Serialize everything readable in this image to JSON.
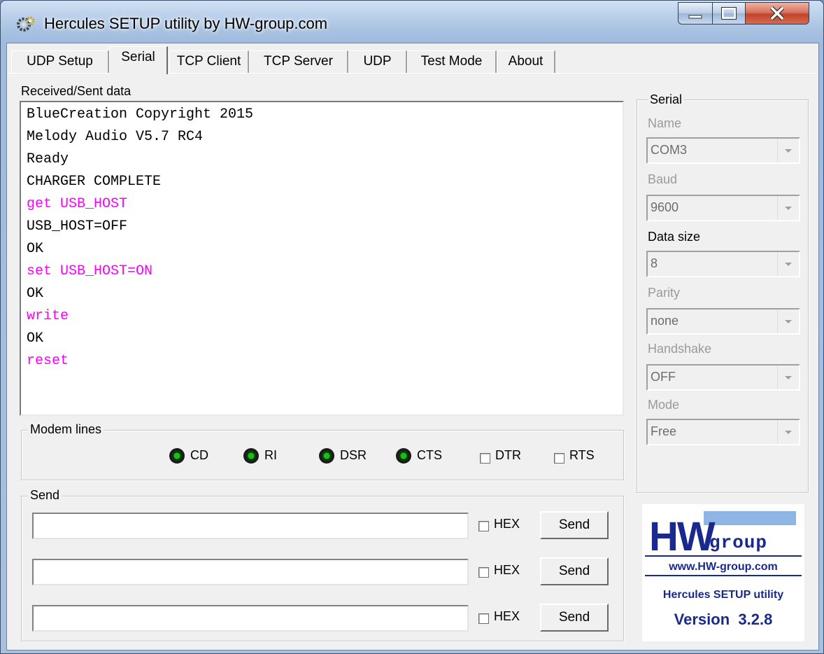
{
  "window": {
    "title": "Hercules SETUP utility by HW-group.com"
  },
  "tabs": [
    {
      "label": "UDP Setup"
    },
    {
      "label": "Serial",
      "active": true
    },
    {
      "label": "TCP Client"
    },
    {
      "label": "TCP Server"
    },
    {
      "label": "UDP"
    },
    {
      "label": "Test Mode"
    },
    {
      "label": "About"
    }
  ],
  "received": {
    "label": "Received/Sent data",
    "lines": [
      {
        "text": "BlueCreation Copyright 2015",
        "kind": "received"
      },
      {
        "text": "Melody Audio V5.7 RC4",
        "kind": "received"
      },
      {
        "text": "Ready",
        "kind": "received"
      },
      {
        "text": "CHARGER COMPLETE",
        "kind": "received"
      },
      {
        "text": "get USB_HOST",
        "kind": "sent"
      },
      {
        "text": "USB_HOST=OFF",
        "kind": "received"
      },
      {
        "text": "OK",
        "kind": "received"
      },
      {
        "text": "set USB_HOST=ON",
        "kind": "sent"
      },
      {
        "text": "OK",
        "kind": "received"
      },
      {
        "text": "write",
        "kind": "sent"
      },
      {
        "text": "OK",
        "kind": "received"
      },
      {
        "text": "reset",
        "kind": "sent"
      }
    ],
    "colors": {
      "received": "#000000",
      "sent": "#ff00ff"
    }
  },
  "modem": {
    "title": "Modem lines",
    "leds": [
      "CD",
      "RI",
      "DSR",
      "CTS"
    ],
    "checks": [
      {
        "label": "DTR",
        "checked": false
      },
      {
        "label": "RTS",
        "checked": false
      }
    ]
  },
  "send": {
    "title": "Send",
    "rows": [
      {
        "value": "",
        "hex_label": "HEX",
        "hex_checked": false,
        "button": "Send"
      },
      {
        "value": "",
        "hex_label": "HEX",
        "hex_checked": false,
        "button": "Send"
      },
      {
        "value": "",
        "hex_label": "HEX",
        "hex_checked": false,
        "button": "Send"
      }
    ]
  },
  "serial": {
    "title": "Serial",
    "name_label": "Name",
    "name_value": "COM3",
    "baud_label": "Baud",
    "baud_value": "9600",
    "datasize_label": "Data size",
    "datasize_value": "8",
    "parity_label": "Parity",
    "parity_value": "none",
    "handshake_label": "Handshake",
    "handshake_value": "OFF",
    "mode_label": "Mode",
    "mode_value": "Free"
  },
  "logo": {
    "brand_main": "HW",
    "brand_sub": "group",
    "url": "www.HW-group.com",
    "product": "Hercules SETUP utility",
    "version": "Version  3.2.8",
    "colors": {
      "navy": "#1a2a8c",
      "light": "#8fb5e6"
    }
  }
}
